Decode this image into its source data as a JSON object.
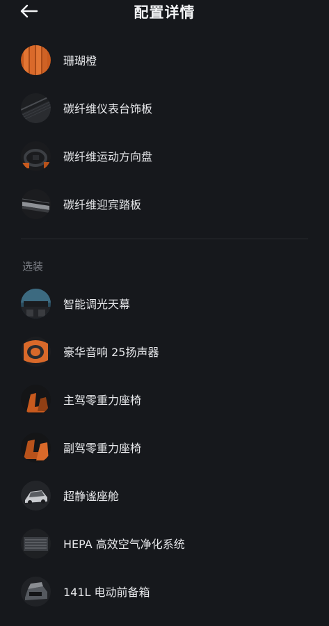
{
  "header": {
    "title": "配置详情",
    "back_icon": "arrow-left-icon"
  },
  "standard_items": [
    {
      "label": "珊瑚橙",
      "icon": "coral-orange-swatch"
    },
    {
      "label": "碳纤维仪表台饰板",
      "icon": "carbon-dashboard-trim"
    },
    {
      "label": "碳纤维运动方向盘",
      "icon": "carbon-steering-wheel"
    },
    {
      "label": "碳纤维迎宾踏板",
      "icon": "carbon-door-sill"
    }
  ],
  "optional_section": {
    "title": "选装",
    "items": [
      {
        "label": "智能调光天幕",
        "icon": "dimming-sunroof"
      },
      {
        "label": "豪华音响 25扬声器",
        "icon": "speaker-system"
      },
      {
        "label": "主驾零重力座椅",
        "icon": "driver-seat"
      },
      {
        "label": "副驾零重力座椅",
        "icon": "passenger-seat"
      },
      {
        "label": "超静谧座舱",
        "icon": "quiet-cabin"
      },
      {
        "label": "HEPA 高效空气净化系统",
        "icon": "air-purifier"
      },
      {
        "label": "141L 电动前备箱",
        "icon": "front-trunk"
      }
    ]
  },
  "colors": {
    "background": "#16181c",
    "accent_orange": "#d9692a",
    "divider": "#2b2e33"
  }
}
